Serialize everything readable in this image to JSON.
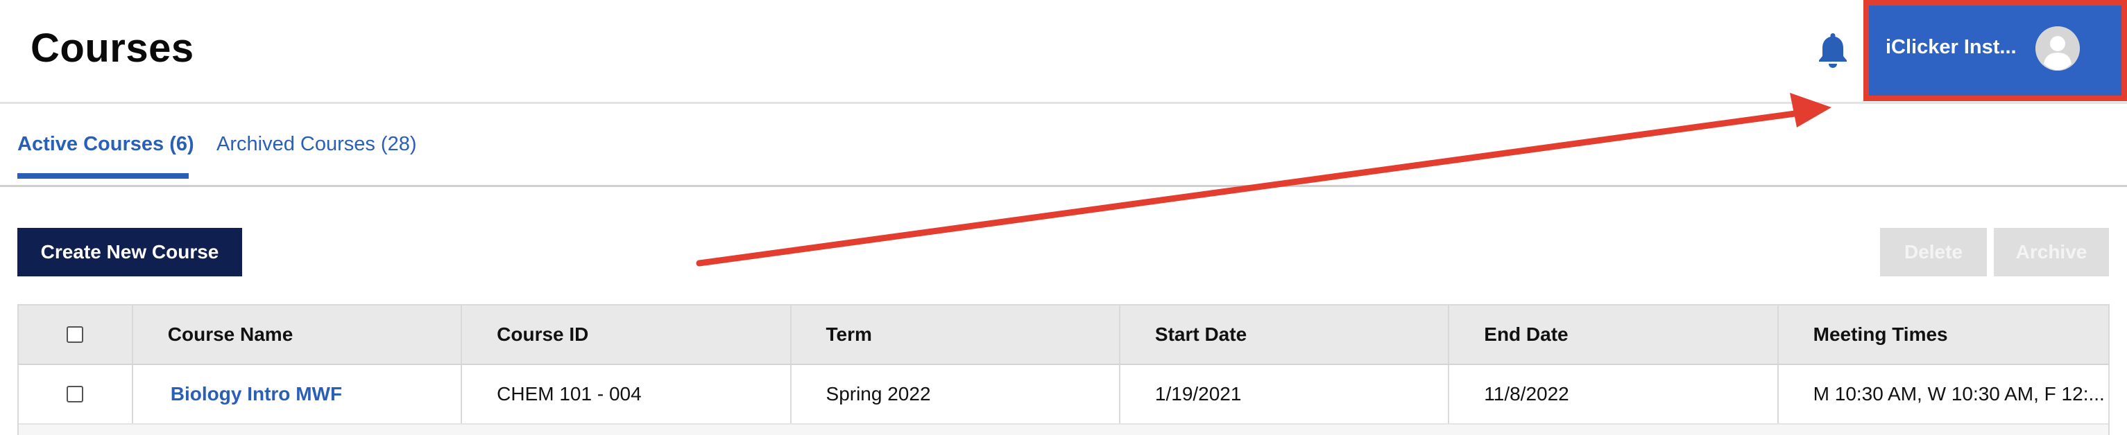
{
  "header": {
    "title": "Courses",
    "user_name": "iClicker Inst...",
    "bell_icon": "bell-icon",
    "avatar_icon": "user-avatar-icon"
  },
  "tabs": [
    {
      "label": "Active Courses (6)",
      "active": true
    },
    {
      "label": "Archived Courses (28)",
      "active": false
    }
  ],
  "actions": {
    "create_label": "Create New Course",
    "delete_label": "Delete",
    "archive_label": "Archive"
  },
  "table": {
    "columns": [
      "Course Name",
      "Course ID",
      "Term",
      "Start Date",
      "End Date",
      "Meeting Times"
    ],
    "rows": [
      {
        "course_name": "Biology Intro MWF",
        "course_id": "CHEM 101 - 004",
        "term": "Spring 2022",
        "start_date": "1/19/2021",
        "end_date": "11/8/2022",
        "meeting_times": "M 10:30 AM, W 10:30 AM, F 12:..."
      }
    ]
  },
  "colors": {
    "accent": "#2a5fb8",
    "primary_button": "#0f1f4f",
    "user_box": "#2f63c3",
    "annotation_red": "#e33d2f"
  }
}
